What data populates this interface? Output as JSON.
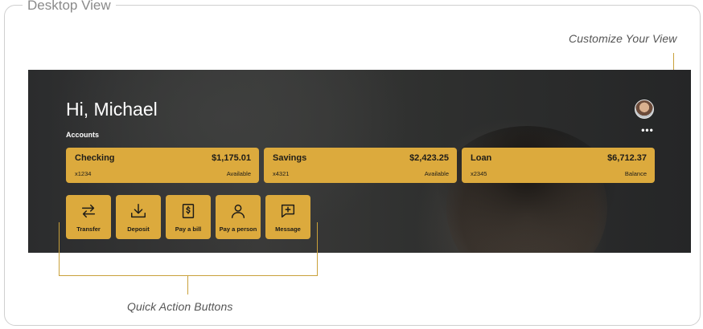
{
  "frame": {
    "title": "Desktop View"
  },
  "annotations": {
    "customize": "Customize Your View",
    "quick_actions": "Quick Action Buttons"
  },
  "dashboard": {
    "greeting": "Hi, Michael",
    "accounts_label": "Accounts",
    "more_icon": "•••",
    "accent_color": "#dcaa3d",
    "accounts": [
      {
        "name": "Checking",
        "amount": "$1,175.01",
        "number": "x1234",
        "status": "Available"
      },
      {
        "name": "Savings",
        "amount": "$2,423.25",
        "number": "x4321",
        "status": "Available"
      },
      {
        "name": "Loan",
        "amount": "$6,712.37",
        "number": "x2345",
        "status": "Balance"
      }
    ],
    "quick_actions": [
      {
        "label": "Transfer",
        "icon": "transfer-icon"
      },
      {
        "label": "Deposit",
        "icon": "deposit-icon"
      },
      {
        "label": "Pay a bill",
        "icon": "bill-icon"
      },
      {
        "label": "Pay a person",
        "icon": "person-icon"
      },
      {
        "label": "Message",
        "icon": "message-icon"
      }
    ]
  }
}
